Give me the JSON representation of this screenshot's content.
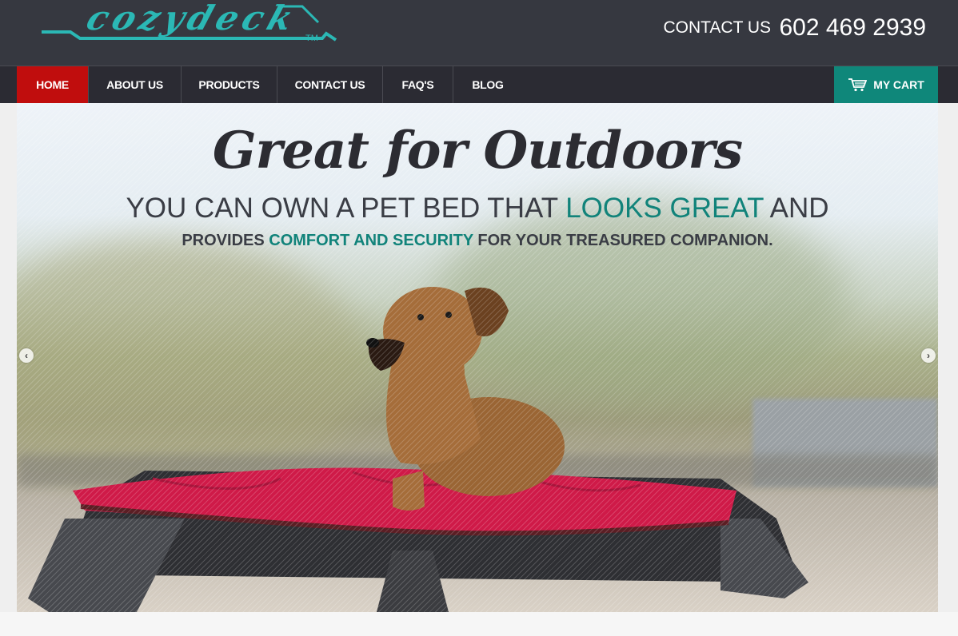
{
  "brand": {
    "logo_text": "cozydeck",
    "logo_tm": "TM",
    "accent": "#2bb8b5"
  },
  "header": {
    "contact_label": "CONTACT US",
    "phone": "602 469 2939"
  },
  "nav": {
    "items": [
      {
        "label": "HOME",
        "active": true
      },
      {
        "label": "ABOUT US"
      },
      {
        "label": "PRODUCTS"
      },
      {
        "label": "CONTACT US"
      },
      {
        "label": "FAQ'S"
      },
      {
        "label": "BLOG"
      }
    ],
    "cart_label": "MY CART",
    "active_color": "#c00d0d",
    "cart_color": "#0f877a"
  },
  "hero": {
    "title": "Great for Outdoors",
    "line1_a": "YOU CAN OWN A PET BED THAT ",
    "line1_highlight": "LOOKS GREAT",
    "line1_b": " AND",
    "line2_a": "PROVIDES ",
    "line2_highlight": "COMFORT AND SECURITY",
    "line2_b": " FOR YOUR TREASURED COMPANION.",
    "highlight_color": "#11837a",
    "image": "dog-on-red-cushion-elevated-pet-bed",
    "prev_icon": "chevron-left-icon",
    "next_icon": "chevron-right-icon"
  }
}
